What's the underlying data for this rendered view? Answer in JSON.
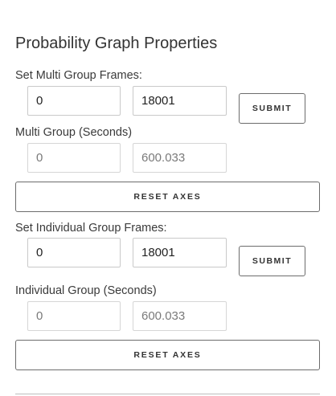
{
  "panel": {
    "title": "Probability Graph Properties"
  },
  "multi_group": {
    "frames_label": "Set Multi Group Frames:",
    "frame_start": "0",
    "frame_end": "18001",
    "submit_label": "SUBMIT",
    "seconds_label": "Multi Group (Seconds)",
    "seconds_start": "0",
    "seconds_end": "600.033",
    "reset_label": "RESET AXES"
  },
  "individual_group": {
    "frames_label": "Set Individual Group Frames:",
    "frame_start": "0",
    "frame_end": "18001",
    "submit_label": "SUBMIT",
    "seconds_label": "Individual Group (Seconds)",
    "seconds_start": "0",
    "seconds_end": "600.033",
    "reset_label": "RESET AXES"
  }
}
